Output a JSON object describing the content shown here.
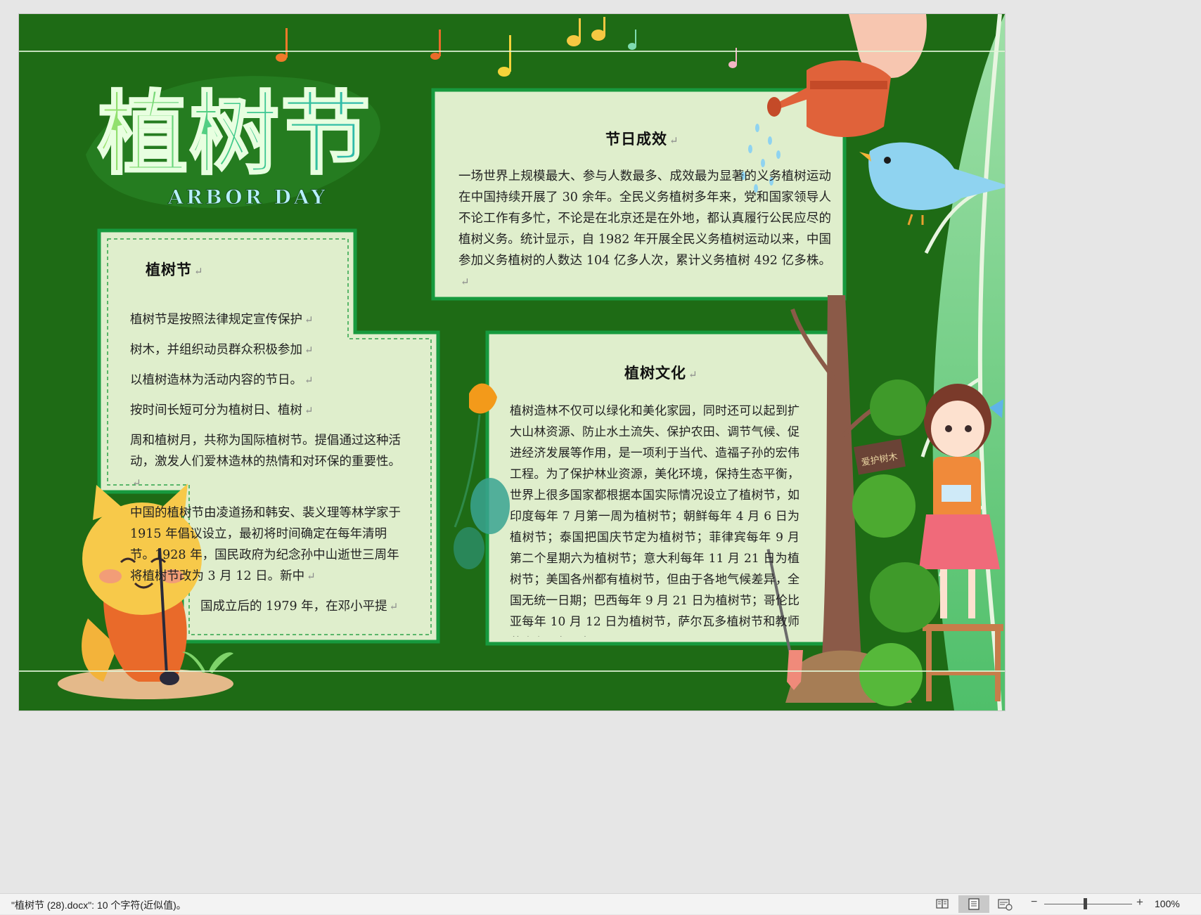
{
  "poster": {
    "title_cn": "植树节",
    "title_en": "ARBOR DAY",
    "sign_text": "爱护树木",
    "paragraph_mark": "↵",
    "panel_left": {
      "heading": "植树节",
      "paragraphs": [
        "植树节是按照法律规定宣传保护",
        "树木，并组织动员群众积极参加",
        "以植树造林为活动内容的节日。",
        "按时间长短可分为植树日、植树",
        "周和植树月，共称为国际植树节。提倡通过这种活动，激发人们爱林造林的热情和对环保的重要性。",
        "中国的植树节由凌道扬和韩安、裴义理等林学家于 1915 年倡议设立，最初将时间确定在每年清明节。1928 年，国民政府为纪念孙中山逝世三周年将植树节改为 3 月 12 日。新中",
        "国成立后的 1979 年，在邓小平提"
      ]
    },
    "panel_right_top": {
      "heading": "节日成效",
      "paragraphs": [
        "一场世界上规模最大、参与人数最多、成效最为显著的义务植树运动在中国持续开展了 30 余年。全民义务植树多年来，党和国家领导人不论工作有多忙，不论是在北京还是在外地，都认真履行公民应尽的植树义务。统计显示，自 1982 年开展全民义务植树运动以来，中国参加义务植树的人数达 104 亿多人次，累计义务植树 492 亿多株。"
      ]
    },
    "panel_right_bottom": {
      "heading": "植树文化",
      "paragraphs": [
        "植树造林不仅可以绿化和美化家园，同时还可以起到扩大山林资源、防止水土流失、保护农田、调节气候、促进经济发展等作用，是一项利于当代、造福子孙的宏伟工程。为了保护林业资源，美化环境，保持生态平衡，世界上很多国家都根据本国实际情况设立了植树节，如印度每年 7 月第一周为植树节；朝鲜每年 4 月 6 日为植树节；泰国把国庆节定为植树节；菲律宾每年 9 月第二个星期六为植树节；意大利每年 11 月 21 日为植树节；美国各州都有植树节，但由于各地气候差异，全国无统一日期；巴西每年 9 月 21 日为植树节；哥伦比亚每年 10 月 12 日为植树节，萨尔瓦多植树节和教师节合在一起，每"
      ]
    }
  },
  "statusbar": {
    "doc_info": "\"植树节 (28).docx\": 10 个字符(近似值)。",
    "zoom_level": "100%",
    "zoom_fraction": 0.46,
    "views": [
      "read-mode",
      "print-layout",
      "web-layout"
    ],
    "active_view": "print-layout"
  },
  "colors": {
    "poster_green": "#1e6b15",
    "panel_fill": "#dfeecc",
    "panel_border": "#179a3e",
    "title_green": "#4fd18a",
    "status_bg": "#f3f3f3"
  }
}
